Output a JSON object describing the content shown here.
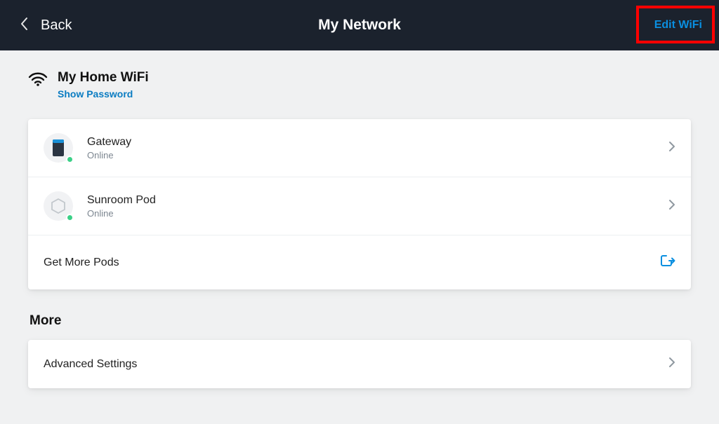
{
  "header": {
    "back_label": "Back",
    "title": "My Network",
    "edit_label": "Edit WiFi"
  },
  "wifi": {
    "name": "My Home WiFi",
    "show_password_label": "Show Password"
  },
  "devices": [
    {
      "name": "Gateway",
      "status": "Online"
    },
    {
      "name": "Sunroom Pod",
      "status": "Online"
    }
  ],
  "more_pods_label": "Get More Pods",
  "more_section_title": "More",
  "advanced_settings_label": "Advanced Settings"
}
